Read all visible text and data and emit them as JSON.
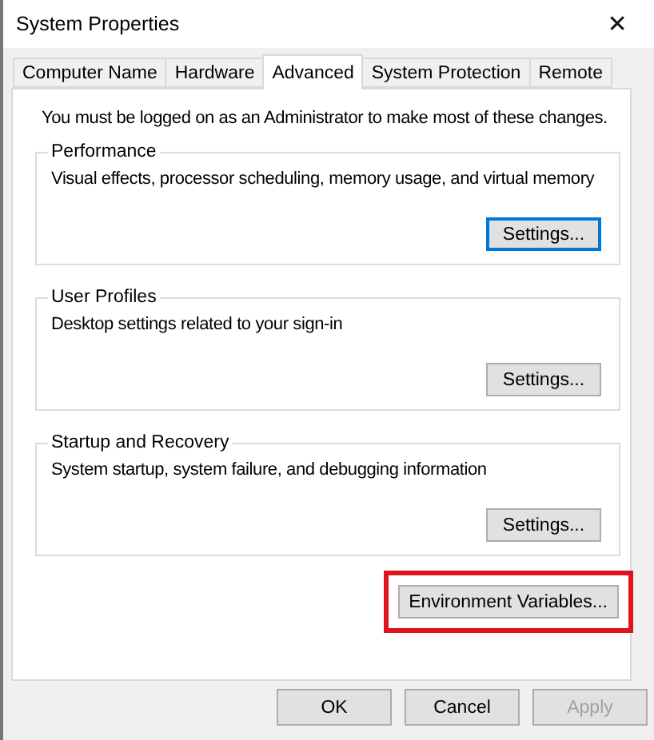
{
  "window": {
    "title": "System Properties",
    "close": "✕"
  },
  "tabs": [
    {
      "label": "Computer Name",
      "selected": false
    },
    {
      "label": "Hardware",
      "selected": false
    },
    {
      "label": "Advanced",
      "selected": true
    },
    {
      "label": "System Protection",
      "selected": false
    },
    {
      "label": "Remote",
      "selected": false
    }
  ],
  "notice": "You must be logged on as an Administrator to make most of these changes.",
  "groups": [
    {
      "title": "Performance",
      "description": "Visual effects, processor scheduling, memory usage, and virtual memory",
      "button": {
        "label": "Settings...",
        "focused": true
      }
    },
    {
      "title": "User Profiles",
      "description": "Desktop settings related to your sign-in",
      "button": {
        "label": "Settings...",
        "focused": false
      }
    },
    {
      "title": "Startup and Recovery",
      "description": "System startup, system failure, and debugging information",
      "button": {
        "label": "Settings...",
        "focused": false
      }
    }
  ],
  "environment_button": {
    "label": "Environment Variables...",
    "highlighted": true
  },
  "buttons": [
    {
      "label": "OK",
      "disabled": false
    },
    {
      "label": "Cancel",
      "disabled": false
    },
    {
      "label": "Apply",
      "disabled": true
    }
  ]
}
